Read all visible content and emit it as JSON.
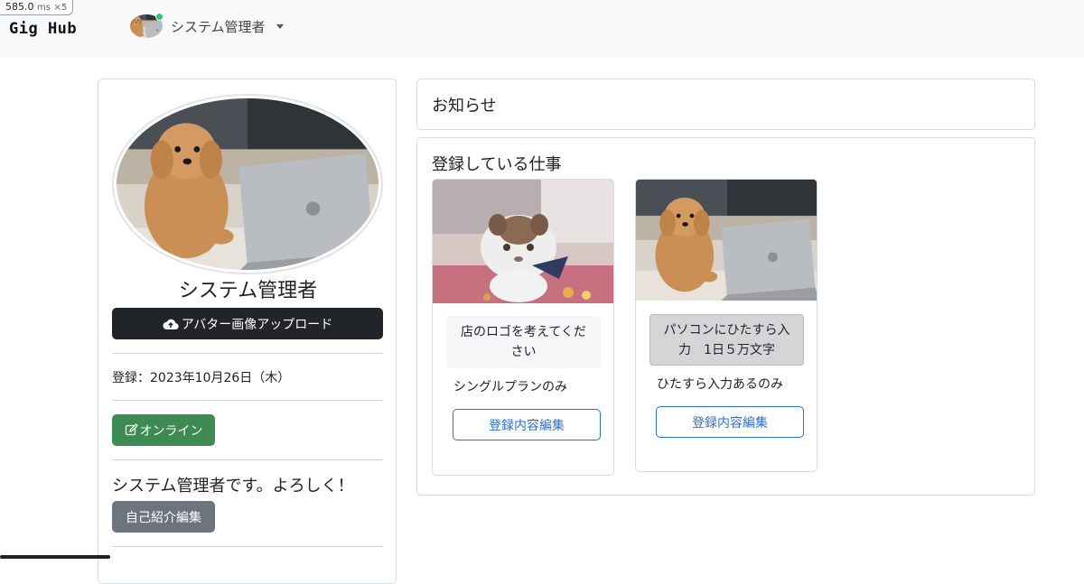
{
  "perf": {
    "value": "585.0",
    "unit": "ms",
    "mult": "×5"
  },
  "navbar": {
    "brand": "Gig Hub",
    "user_name": "システム管理者",
    "avatar_icon": "poodle-avatar-image",
    "status_color": "#28c76f"
  },
  "profile": {
    "name": "システム管理者",
    "upload_label": "アバター画像アップロード",
    "upload_icon": "cloud-upload-icon",
    "registered": "登録：2023年10月26日（木）",
    "online_label": "オンライン",
    "online_icon": "edit-icon",
    "intro": "システム管理者です。よろしく！",
    "edit_intro_label": "自己紹介編集"
  },
  "news": {
    "title": "お知らせ"
  },
  "jobs": {
    "title": "登録している仕事",
    "items": [
      {
        "title": "店のロゴを考えてください",
        "plan": "シングルプランのみ",
        "edit_label": "登録内容編集",
        "image": "cat-photo"
      },
      {
        "title": "パソコンにひたすら入力　1日５万文字",
        "plan": "ひたすら入力あるのみ",
        "edit_label": "登録内容編集",
        "image": "poodle-photo"
      }
    ]
  },
  "colors": {
    "dark_button": "#212529",
    "online_button": "#3d8b52",
    "gray_button": "#6c757d",
    "link_blue": "#2a6fdb"
  }
}
